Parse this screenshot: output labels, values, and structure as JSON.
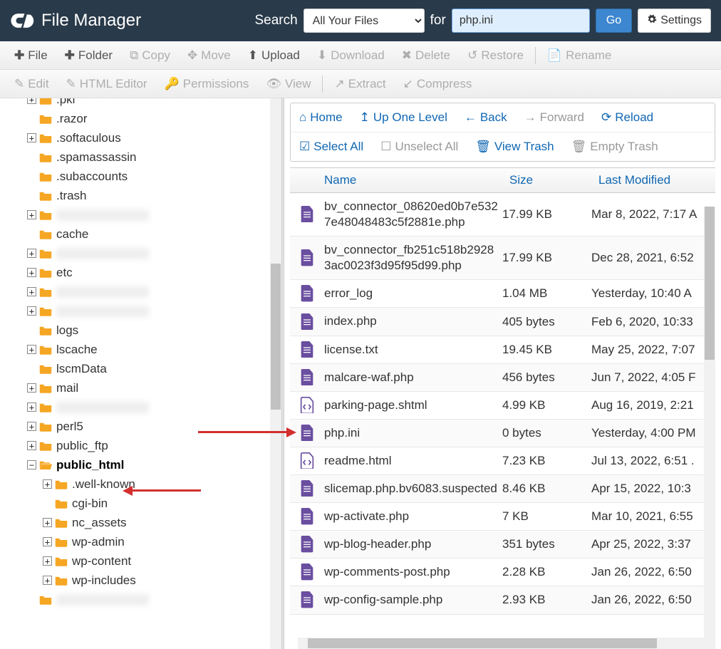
{
  "header": {
    "app_title": "File Manager",
    "search_label": "Search",
    "search_scope": "All Your Files",
    "for_label": "for",
    "search_value": "php.ini",
    "go_label": "Go",
    "settings_label": "Settings"
  },
  "toolbar": {
    "file": "File",
    "folder": "Folder",
    "copy": "Copy",
    "move": "Move",
    "upload": "Upload",
    "download": "Download",
    "delete": "Delete",
    "restore": "Restore",
    "rename": "Rename",
    "edit": "Edit",
    "html_editor": "HTML Editor",
    "permissions": "Permissions",
    "view": "View",
    "extract": "Extract",
    "compress": "Compress"
  },
  "nav": {
    "home": "Home",
    "up": "Up One Level",
    "back": "Back",
    "forward": "Forward",
    "reload": "Reload",
    "select_all": "Select All",
    "unselect_all": "Unselect All",
    "view_trash": "View Trash",
    "empty_trash": "Empty Trash"
  },
  "columns": {
    "name": "Name",
    "size": "Size",
    "modified": "Last Modified"
  },
  "tree": [
    {
      "depth": 1,
      "toggle": "+",
      "icon": "closed",
      "label": ".pki"
    },
    {
      "depth": 1,
      "toggle": "",
      "icon": "closed",
      "label": ".razor"
    },
    {
      "depth": 1,
      "toggle": "+",
      "icon": "closed",
      "label": ".softaculous"
    },
    {
      "depth": 1,
      "toggle": "",
      "icon": "closed",
      "label": ".spamassassin"
    },
    {
      "depth": 1,
      "toggle": "",
      "icon": "closed",
      "label": ".subaccounts"
    },
    {
      "depth": 1,
      "toggle": "",
      "icon": "closed",
      "label": ".trash"
    },
    {
      "depth": 1,
      "toggle": "+",
      "icon": "closed",
      "label": "",
      "blurred": true
    },
    {
      "depth": 1,
      "toggle": "",
      "icon": "closed",
      "label": "cache"
    },
    {
      "depth": 1,
      "toggle": "+",
      "icon": "closed",
      "label": "",
      "blurred": true
    },
    {
      "depth": 1,
      "toggle": "+",
      "icon": "closed",
      "label": "etc"
    },
    {
      "depth": 1,
      "toggle": "+",
      "icon": "closed",
      "label": "",
      "blurred": true
    },
    {
      "depth": 1,
      "toggle": "+",
      "icon": "closed",
      "label": "",
      "blurred": true
    },
    {
      "depth": 1,
      "toggle": "",
      "icon": "closed",
      "label": "logs"
    },
    {
      "depth": 1,
      "toggle": "+",
      "icon": "closed",
      "label": "lscache"
    },
    {
      "depth": 1,
      "toggle": "",
      "icon": "closed",
      "label": "lscmData"
    },
    {
      "depth": 1,
      "toggle": "+",
      "icon": "closed",
      "label": "mail"
    },
    {
      "depth": 1,
      "toggle": "+",
      "icon": "closed",
      "label": "",
      "blurred": true
    },
    {
      "depth": 1,
      "toggle": "+",
      "icon": "closed",
      "label": "perl5"
    },
    {
      "depth": 1,
      "toggle": "+",
      "icon": "closed",
      "label": "public_ftp"
    },
    {
      "depth": 1,
      "toggle": "-",
      "icon": "open",
      "label": "public_html",
      "selected": true
    },
    {
      "depth": 2,
      "toggle": "+",
      "icon": "closed",
      "label": ".well-known"
    },
    {
      "depth": 2,
      "toggle": "",
      "icon": "closed",
      "label": "cgi-bin"
    },
    {
      "depth": 2,
      "toggle": "+",
      "icon": "closed",
      "label": "nc_assets"
    },
    {
      "depth": 2,
      "toggle": "+",
      "icon": "closed",
      "label": "wp-admin"
    },
    {
      "depth": 2,
      "toggle": "+",
      "icon": "closed",
      "label": "wp-content"
    },
    {
      "depth": 2,
      "toggle": "+",
      "icon": "closed",
      "label": "wp-includes"
    },
    {
      "depth": 1,
      "toggle": "",
      "icon": "closed",
      "label": "",
      "blurred": true
    }
  ],
  "files": [
    {
      "name": "bv_connector_08620ed0b7e5327e48048483c5f2881e.php",
      "size": "17.99 KB",
      "mod": "Mar 8, 2022, 7:17 A",
      "type": "doc"
    },
    {
      "name": "bv_connector_fb251c518b29283ac0023f3d95f95d99.php",
      "size": "17.99 KB",
      "mod": "Dec 28, 2021, 6:52",
      "type": "doc"
    },
    {
      "name": "error_log",
      "size": "1.04 MB",
      "mod": "Yesterday, 10:40 A",
      "type": "doc"
    },
    {
      "name": "index.php",
      "size": "405 bytes",
      "mod": "Feb 6, 2020, 10:33",
      "type": "doc"
    },
    {
      "name": "license.txt",
      "size": "19.45 KB",
      "mod": "May 25, 2022, 7:07",
      "type": "doc"
    },
    {
      "name": "malcare-waf.php",
      "size": "456 bytes",
      "mod": "Jun 7, 2022, 4:05 F",
      "type": "doc"
    },
    {
      "name": "parking-page.shtml",
      "size": "4.99 KB",
      "mod": "Aug 16, 2019, 2:21",
      "type": "code"
    },
    {
      "name": "php.ini",
      "size": "0 bytes",
      "mod": "Yesterday, 4:00 PM",
      "type": "doc"
    },
    {
      "name": "readme.html",
      "size": "7.23 KB",
      "mod": "Jul 13, 2022, 6:51 .",
      "type": "code"
    },
    {
      "name": "slicemap.php.bv6083.suspected",
      "size": "8.46 KB",
      "mod": "Apr 15, 2022, 10:3",
      "type": "doc"
    },
    {
      "name": "wp-activate.php",
      "size": "7 KB",
      "mod": "Mar 10, 2021, 6:55",
      "type": "doc"
    },
    {
      "name": "wp-blog-header.php",
      "size": "351 bytes",
      "mod": "Apr 25, 2022, 3:37",
      "type": "doc"
    },
    {
      "name": "wp-comments-post.php",
      "size": "2.28 KB",
      "mod": "Jan 26, 2022, 6:50",
      "type": "doc"
    },
    {
      "name": "wp-config-sample.php",
      "size": "2.93 KB",
      "mod": "Jan 26, 2022, 6:50",
      "type": "doc"
    }
  ]
}
